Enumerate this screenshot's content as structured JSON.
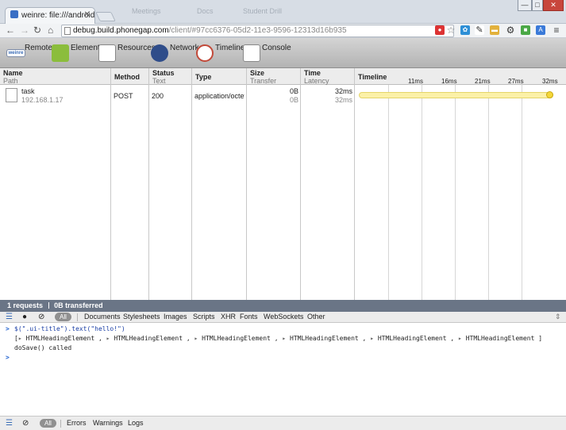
{
  "browser": {
    "tab_title": "weinre: file:///android_as",
    "faded_tabs": [
      "Meetings",
      "Docs",
      "Student Drill"
    ],
    "url_host": "debug.build.phonegap.com",
    "url_path": "/client/#97cc6376-05d2-11e3-9596-12313d16b935"
  },
  "devtools": {
    "panels": [
      {
        "label": "Remote",
        "icon": "weinre-icon",
        "color": "#3b6db7"
      },
      {
        "label": "Elements",
        "icon": "elements-icon",
        "color": "#8bbd3c"
      },
      {
        "label": "Resources",
        "icon": "resources-icon",
        "color": "#5d6f8c"
      },
      {
        "label": "Network",
        "icon": "network-icon",
        "color": "#2f4d8a"
      },
      {
        "label": "Timeline",
        "icon": "timeline-icon",
        "color": "#c24a3a"
      },
      {
        "label": "Console",
        "icon": "console-icon",
        "color": "#d98b2b"
      }
    ],
    "remote_badge": "weinre"
  },
  "network": {
    "columns": [
      {
        "title": "Name",
        "sub": "Path"
      },
      {
        "title": "Method",
        "sub": ""
      },
      {
        "title": "Status",
        "sub": "Text"
      },
      {
        "title": "Type",
        "sub": ""
      },
      {
        "title": "Size",
        "sub": "Transfer"
      },
      {
        "title": "Time",
        "sub": "Latency"
      },
      {
        "title": "Timeline",
        "sub": ""
      }
    ],
    "ticks": [
      "11ms",
      "16ms",
      "21ms",
      "27ms",
      "32ms"
    ],
    "rows": [
      {
        "name": "task",
        "path": "192.168.1.17",
        "method": "POST",
        "status": "200",
        "type": "application/octet...",
        "size": "0B",
        "transfer": "0B",
        "time": "32ms",
        "latency": "32ms"
      }
    ],
    "summary_requests": "1 requests",
    "summary_transferred": "0B transferred"
  },
  "filters": {
    "top": [
      "All",
      "Documents",
      "Stylesheets",
      "Images",
      "Scripts",
      "XHR",
      "Fonts",
      "WebSockets",
      "Other"
    ],
    "bottom": [
      "All",
      "Errors",
      "Warnings",
      "Logs"
    ]
  },
  "console": {
    "command": "$(\".ui-title\").text(\"hello!\")",
    "result_open": "[",
    "result_item": "HTMLHeadingElement",
    "result_sep": ",",
    "result_close": "]",
    "log": "doSave() called",
    "prompt": ">"
  },
  "colors": {
    "accent": "#6a7586",
    "timeline_bar": "#fbf1a8"
  }
}
